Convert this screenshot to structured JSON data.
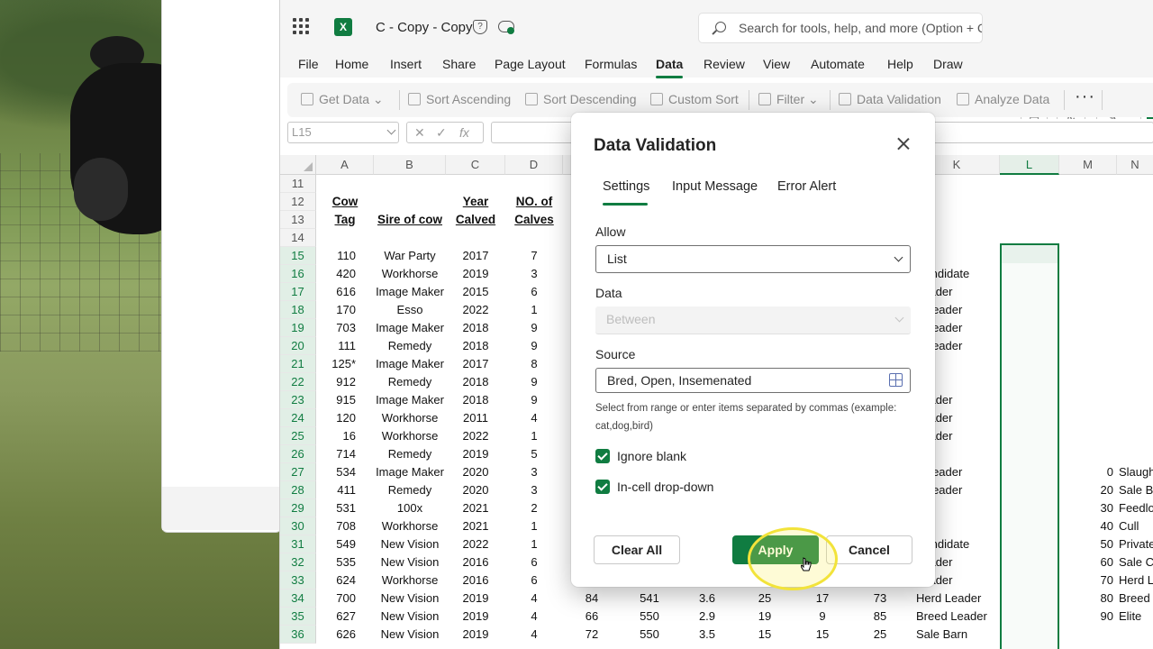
{
  "window": {
    "doc_title": "C - Copy - Copy",
    "search_placeholder": "Search for tools, help, and more (Option + Q)"
  },
  "menu": [
    "File",
    "Home",
    "Insert",
    "Share",
    "Page Layout",
    "Formulas",
    "Data",
    "Review",
    "View",
    "Automate",
    "Help",
    "Draw"
  ],
  "active_menu": "Data",
  "ribbon": {
    "get_data": "Get Data",
    "sort_asc": "Sort Ascending",
    "sort_desc": "Sort Descending",
    "custom_sort": "Custom Sort",
    "filter": "Filter",
    "data_validation": "Data Validation",
    "analyze_data": "Analyze Data",
    "more": "···"
  },
  "formula_bar": {
    "name_box": "L15",
    "fx": "fx"
  },
  "columns": [
    "A",
    "B",
    "C",
    "D",
    "K",
    "L",
    "M",
    "N"
  ],
  "headers": {
    "cow_tag_1": "Cow",
    "cow_tag_2": "Tag",
    "sire": "Sire of cow",
    "year_1": "Year",
    "year_2": "Calved",
    "calves_1": "NO. of",
    "calves_2": "Calves"
  },
  "rows": [
    {
      "n": "11",
      "a": "",
      "b": "",
      "c": "",
      "d": "",
      "k": "",
      "m": "",
      "n2": ""
    },
    {
      "n": "12",
      "a": "",
      "b": "",
      "c": "",
      "d": "",
      "k": "",
      "m": "",
      "n2": ""
    },
    {
      "n": "13",
      "a": "",
      "b": "",
      "c": "",
      "d": "",
      "k": "",
      "m": "",
      "n2": ""
    },
    {
      "n": "14",
      "a": "",
      "b": "",
      "c": "",
      "d": "",
      "k": "",
      "m": "",
      "n2": ""
    },
    {
      "n": "15",
      "a": "110",
      "b": "War Party",
      "c": "2017",
      "d": "7",
      "k": "",
      "m": "",
      "n2": ""
    },
    {
      "n": "16",
      "a": "420",
      "b": "Workhorse",
      "c": "2019",
      "d": "3",
      "k": "Candidate",
      "m": "",
      "n2": ""
    },
    {
      "n": "17",
      "a": "616",
      "b": "Image Maker",
      "c": "2015",
      "d": "6",
      "k": "Leader",
      "m": "",
      "n2": ""
    },
    {
      "n": "18",
      "a": "170",
      "b": "Esso",
      "c": "2022",
      "d": "1",
      "k": "d Leader",
      "m": "",
      "n2": ""
    },
    {
      "n": "19",
      "a": "703",
      "b": "Image Maker",
      "c": "2018",
      "d": "9",
      "k": "d Leader",
      "m": "",
      "n2": ""
    },
    {
      "n": "20",
      "a": "111",
      "b": "Remedy",
      "c": "2018",
      "d": "9",
      "k": "d Leader",
      "m": "",
      "n2": ""
    },
    {
      "n": "21",
      "a": "125*",
      "b": "Image Maker",
      "c": "2017",
      "d": "8",
      "k": "",
      "m": "",
      "n2": ""
    },
    {
      "n": "22",
      "a": "912",
      "b": "Remedy",
      "c": "2018",
      "d": "9",
      "k": "",
      "m": "",
      "n2": ""
    },
    {
      "n": "23",
      "a": "915",
      "b": "Image Maker",
      "c": "2018",
      "d": "9",
      "k": "Leader",
      "m": "",
      "n2": ""
    },
    {
      "n": "24",
      "a": "120",
      "b": "Workhorse",
      "c": "2011",
      "d": "4",
      "k": "Leader",
      "m": "",
      "n2": ""
    },
    {
      "n": "25",
      "a": "16",
      "b": "Workhorse",
      "c": "2022",
      "d": "1",
      "k": "Leader",
      "m": "",
      "n2": ""
    },
    {
      "n": "26",
      "a": "714",
      "b": "Remedy",
      "c": "2019",
      "d": "5",
      "k": "",
      "m": "",
      "n2": ""
    },
    {
      "n": "27",
      "a": "534",
      "b": "Image Maker",
      "c": "2020",
      "d": "3",
      "k": "d Leader",
      "m": "0",
      "n2": "Slaugh"
    },
    {
      "n": "28",
      "a": "411",
      "b": "Remedy",
      "c": "2020",
      "d": "3",
      "k": "d Leader",
      "m": "20",
      "n2": "Sale Ba"
    },
    {
      "n": "29",
      "a": "531",
      "b": "100x",
      "c": "2021",
      "d": "2",
      "k": "",
      "m": "30",
      "n2": "Feedlo"
    },
    {
      "n": "30",
      "a": "708",
      "b": "Workhorse",
      "c": "2021",
      "d": "1",
      "k": "",
      "m": "40",
      "n2": "Cull"
    },
    {
      "n": "31",
      "a": "549",
      "b": "New Vision",
      "c": "2022",
      "d": "1",
      "k": "Candidate",
      "m": "50",
      "n2": "Private"
    },
    {
      "n": "32",
      "a": "535",
      "b": "New Vision",
      "c": "2016",
      "d": "6",
      "k": "Leader",
      "m": "60",
      "n2": "Sale Ca"
    },
    {
      "n": "33",
      "a": "624",
      "b": "Workhorse",
      "c": "2016",
      "d": "6",
      "k": "Leader",
      "m": "70",
      "n2": "Herd L"
    },
    {
      "n": "34",
      "a": "700",
      "b": "New Vision",
      "c": "2019",
      "d": "4",
      "k": "Herd Leader",
      "m": "80",
      "n2": "Breed L"
    },
    {
      "n": "35",
      "a": "627",
      "b": "New Vision",
      "c": "2019",
      "d": "4",
      "k": "Breed Leader",
      "m": "90",
      "n2": "Elite"
    },
    {
      "n": "36",
      "a": "626",
      "b": "New Vision",
      "c": "2019",
      "d": "4",
      "k": "Sale Barn",
      "m": "",
      "n2": ""
    }
  ],
  "visible_mid": [
    {
      "row": "34",
      "e": "84",
      "f": "541",
      "g": "3.6",
      "h": "25",
      "i": "17",
      "j": "73"
    },
    {
      "row": "35",
      "e": "66",
      "f": "550",
      "g": "2.9",
      "h": "19",
      "i": "9",
      "j": "85"
    },
    {
      "row": "36",
      "e": "72",
      "f": "550",
      "g": "3.5",
      "h": "15",
      "i": "15",
      "j": "25"
    }
  ],
  "dialog": {
    "title": "Data Validation",
    "tabs": [
      "Settings",
      "Input Message",
      "Error Alert"
    ],
    "allow_label": "Allow",
    "allow_value": "List",
    "data_label": "Data",
    "data_value": "Between",
    "source_label": "Source",
    "source_value": "Bred, Open, Insemenated",
    "hint": "Select from range or enter items separated by commas (example: cat,dog,bird)",
    "ignore_blank": "Ignore blank",
    "in_cell": "In-cell drop-down",
    "clear_all": "Clear All",
    "apply": "Apply",
    "cancel": "Cancel"
  },
  "colors": {
    "accent": "#107c41"
  }
}
